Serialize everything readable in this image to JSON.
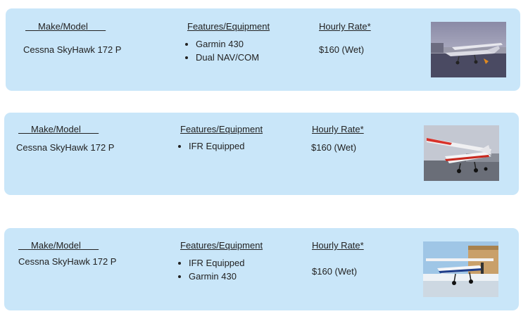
{
  "listings": [
    {
      "header_make": "     Make/Model       ",
      "header_features": "Features/Equipment",
      "header_rate": "Hourly Rate*",
      "model": "Cessna SkyHawk 172 P",
      "features": [
        "Garmin 430",
        "Dual NAV/COM"
      ],
      "rate": "$160 (Wet)",
      "photo": "cessna-photo-overcast-ramp"
    },
    {
      "header_make": "     Make/Model       ",
      "header_features": "Features/Equipment",
      "header_rate": "Hourly Rate*",
      "model": "Cessna SkyHawk 172 P",
      "features": [
        "IFR Equipped"
      ],
      "rate": "$160 (Wet)",
      "photo": "cessna-photo-red-stripe"
    },
    {
      "header_make": "     Make/Model       ",
      "header_features": "Features/Equipment",
      "header_rate": "Hourly Rate*",
      "model": "Cessna SkyHawk 172 P",
      "features": [
        "IFR Equipped",
        "Garmin 430"
      ],
      "rate": "$160 (Wet)",
      "photo": "cessna-photo-snow-hangar"
    }
  ],
  "colors": {
    "card_bg": "#c9e6f9",
    "text": "#222222"
  }
}
